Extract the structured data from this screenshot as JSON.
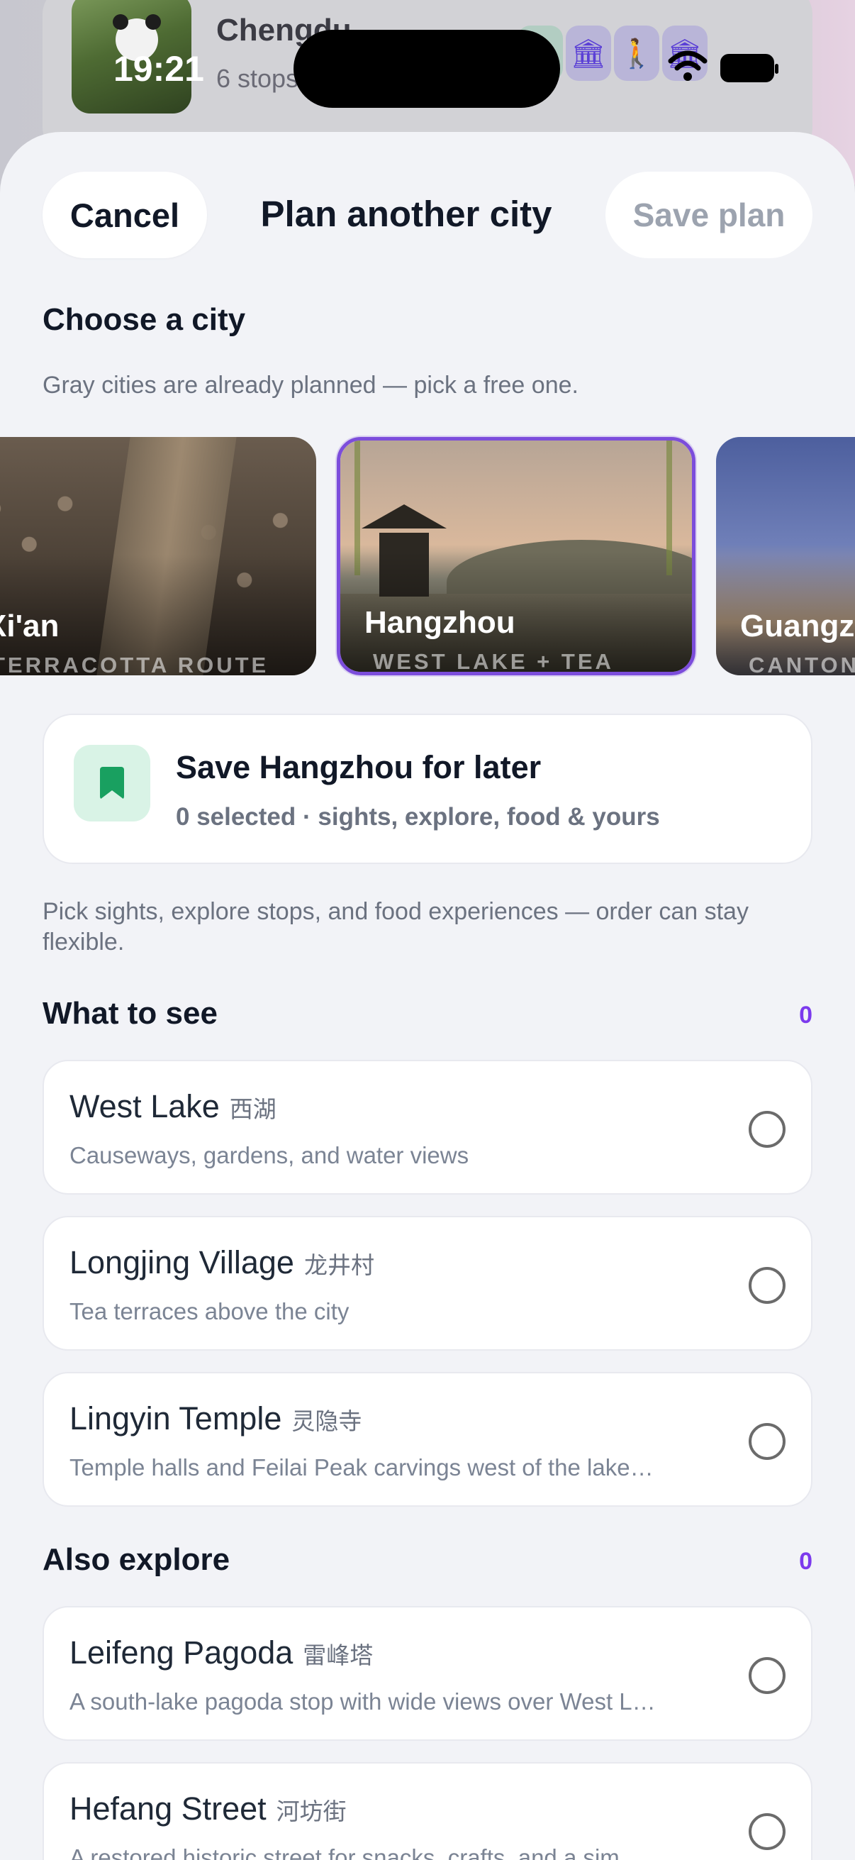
{
  "status_bar": {
    "time": "19:21"
  },
  "background_card": {
    "title": "Chengdu",
    "subtitle": "6 stops",
    "count": "6"
  },
  "header": {
    "cancel_label": "Cancel",
    "title": "Plan another city",
    "save_label": "Save plan"
  },
  "choose_city": {
    "heading": "Choose a city",
    "helper": "Gray cities are already planned — pick a free one.",
    "cities": [
      {
        "name": "Xi'an",
        "tagline": "TERRACOTTA ROUTE"
      },
      {
        "name": "Hangzhou",
        "tagline": "WEST LAKE + TEA",
        "selected": true
      },
      {
        "name": "Guangzhou",
        "tagline": "CANTON"
      }
    ]
  },
  "save_card": {
    "title": "Save Hangzhou for later",
    "subtitle": "0 selected · sights, explore, food & yours"
  },
  "intro": "Pick sights, explore stops, and food experiences — order can stay flexible.",
  "what_to_see": {
    "heading": "What to see",
    "count": "0",
    "items": [
      {
        "name": "West Lake",
        "name_cn": "西湖",
        "desc": "Causeways, gardens, and water views"
      },
      {
        "name": "Longjing Village",
        "name_cn": "龙井村",
        "desc": "Tea terraces above the city"
      },
      {
        "name": "Lingyin Temple",
        "name_cn": "灵隐寺",
        "desc": "Temple halls and Feilai Peak carvings west of the lake…"
      }
    ]
  },
  "also_explore": {
    "heading": "Also explore",
    "count": "0",
    "items": [
      {
        "name": "Leifeng Pagoda",
        "name_cn": "雷峰塔",
        "desc": "A south-lake pagoda stop with wide views over West L…"
      },
      {
        "name": "Hefang Street",
        "name_cn": "河坊街",
        "desc": "A restored historic street for snacks, crafts, and a sim…"
      }
    ]
  },
  "colors": {
    "accent": "#7c3aed",
    "selected_border": "#7c4ddb",
    "bookmark": "#19a060"
  }
}
